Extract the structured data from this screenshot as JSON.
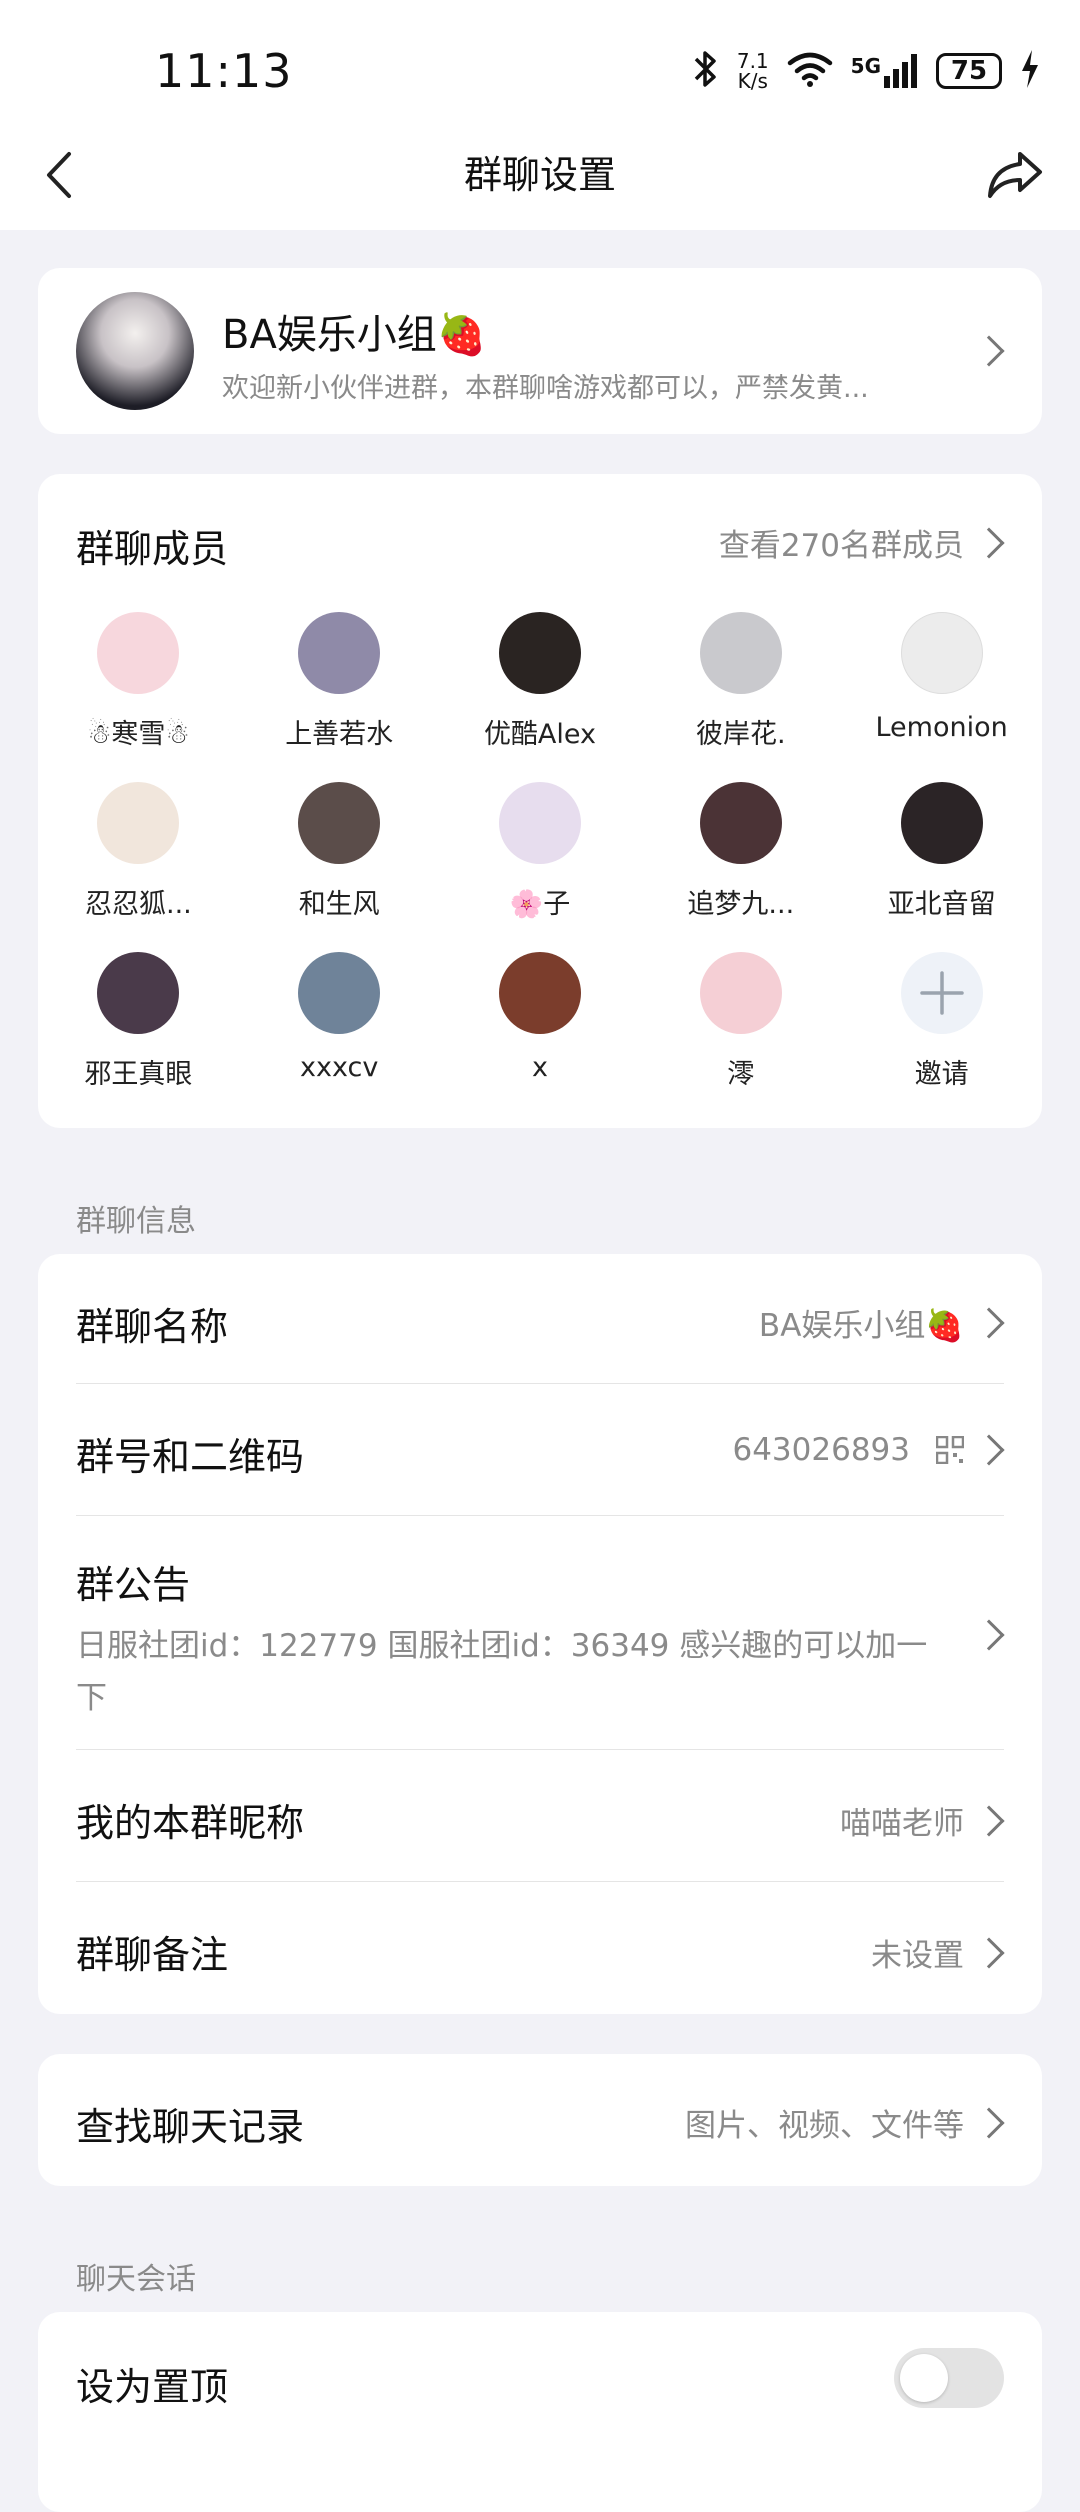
{
  "status_bar": {
    "time": "11:13",
    "net_speed_top": "7.1",
    "net_speed_bottom": "K/s",
    "network": "5G",
    "battery": "75"
  },
  "nav": {
    "title": "群聊设置"
  },
  "group": {
    "name": "BA娱乐小组🍓",
    "description": "欢迎新小伙伴进群，本群聊啥游戏都可以，严禁发黄..."
  },
  "members": {
    "title": "群聊成员",
    "view_all": "查看270名群成员",
    "list": [
      {
        "name": "☃寒雪☃",
        "color": "#f7d7dd"
      },
      {
        "name": "上善若水",
        "color": "#8f8aa8"
      },
      {
        "name": "优酷Alex",
        "color": "#2a2422"
      },
      {
        "name": "彼岸花.",
        "color": "#c9c9cd"
      },
      {
        "name": "Lemonion",
        "color": "#ececec"
      },
      {
        "name": "忍忍狐...",
        "color": "#f1e6dc"
      },
      {
        "name": "和生风",
        "color": "#5b4d4a"
      },
      {
        "name": "🌸子",
        "color": "#e7ddee"
      },
      {
        "name": "追梦九...",
        "color": "#4b3336"
      },
      {
        "name": "亚北音留",
        "color": "#2b2426"
      },
      {
        "name": "邪王真眼",
        "color": "#4a3a4a"
      },
      {
        "name": "xxxcv",
        "color": "#6f8399"
      },
      {
        "name": "x",
        "color": "#7b3d2c"
      },
      {
        "name": "澪",
        "color": "#f5cfd5"
      }
    ],
    "invite_label": "邀请"
  },
  "info_section": {
    "label": "群聊信息",
    "group_name_label": "群聊名称",
    "group_name_value": "BA娱乐小组🍓",
    "group_number_label": "群号和二维码",
    "group_number_value": "643026893",
    "notice_label": "群公告",
    "notice_text": "日服社团id：122779 国服社团id：36349 感兴趣的可以加一下",
    "my_nickname_label": "我的本群昵称",
    "my_nickname_value": "喵喵老师",
    "remark_label": "群聊备注",
    "remark_value": "未设置"
  },
  "search": {
    "label": "查找聊天记录",
    "value": "图片、视频、文件等"
  },
  "session_section": {
    "label": "聊天会话",
    "pin_label": "设为置顶",
    "pin_enabled": false
  }
}
